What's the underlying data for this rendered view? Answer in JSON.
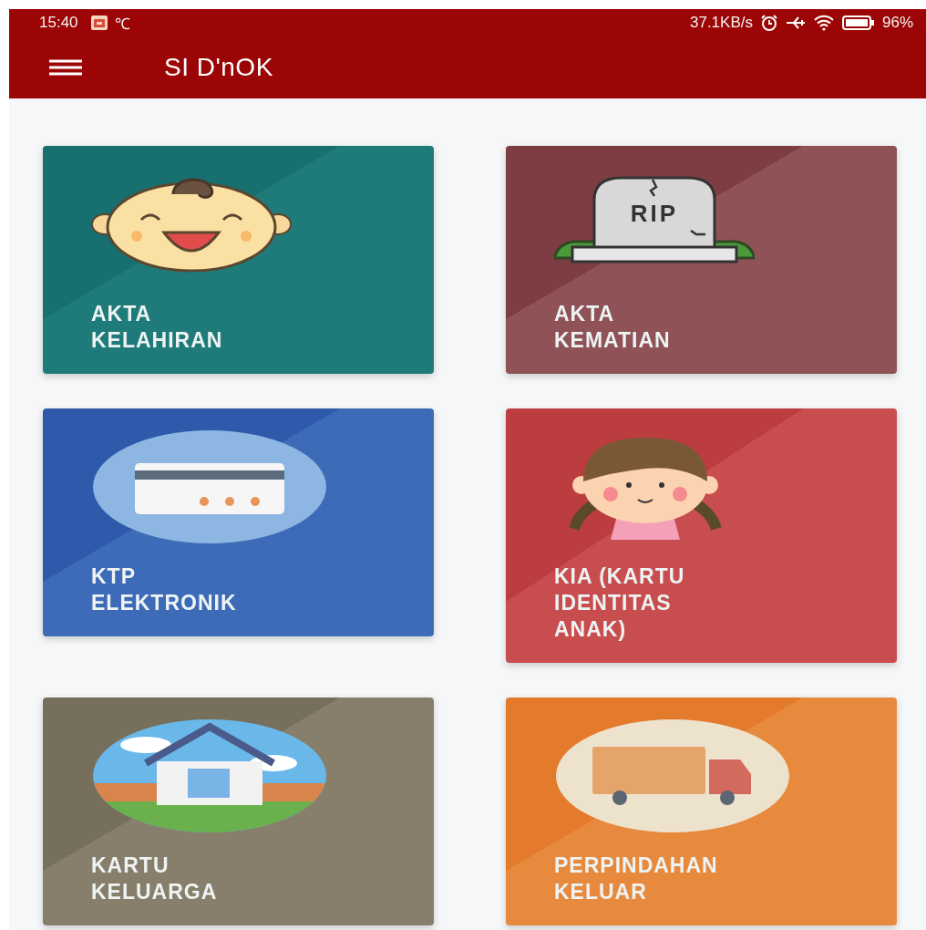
{
  "status_bar": {
    "time": "15:40",
    "temperature_unit": "℃",
    "network_speed": "37.1KB/s",
    "battery": "96%"
  },
  "app_bar": {
    "title": "SI D'nOK"
  },
  "tombstone_engraving": "RIP",
  "cards": [
    {
      "kind": "baby",
      "label": "AKTA\nKELAHIRAN"
    },
    {
      "kind": "tombstone",
      "label": "AKTA\nKEMATIAN"
    },
    {
      "kind": "id-card",
      "label": "KTP\nELEKTRONIK"
    },
    {
      "kind": "girl",
      "label": "KIA (KARTU\nIDENTITAS\nANAK)"
    },
    {
      "kind": "house",
      "label": "KARTU\nKELUARGA"
    },
    {
      "kind": "truck",
      "label": "PERPINDAHAN\nKELUAR"
    }
  ]
}
